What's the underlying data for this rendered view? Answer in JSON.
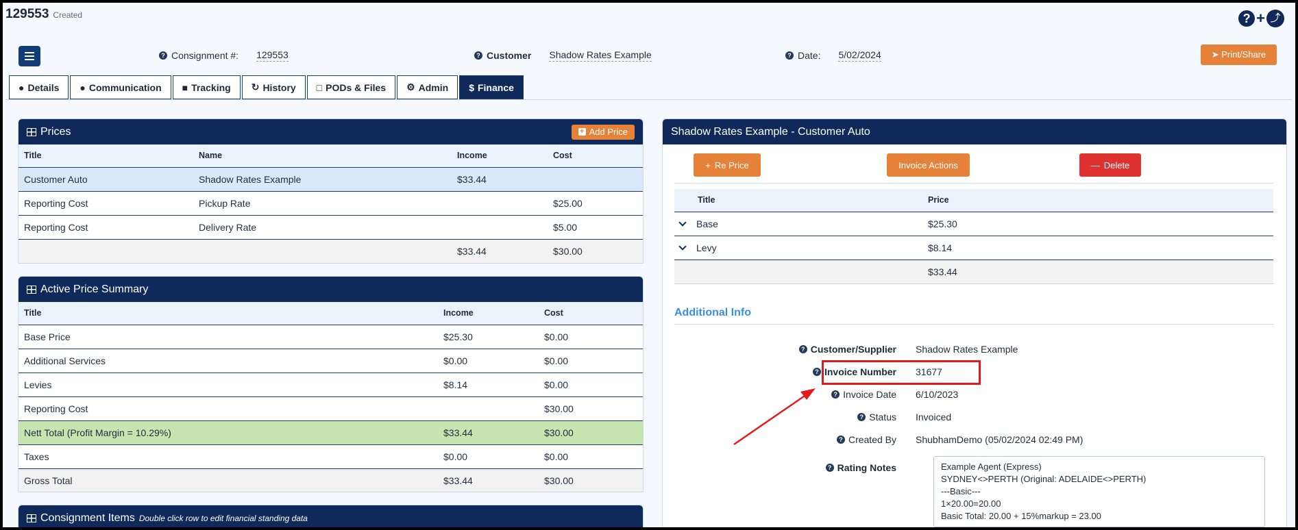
{
  "header": {
    "id": "129553",
    "status": "Created"
  },
  "fields": {
    "consignment_label": "Consignment #:",
    "consignment_value": "129553",
    "customer_label": "Customer",
    "customer_value": "Shadow Rates Example",
    "date_label": "Date:",
    "date_value": "5/02/2024"
  },
  "print_label": "Print/Share",
  "tabs": [
    {
      "label": "Details",
      "icon": "user-icon"
    },
    {
      "label": "Communication",
      "icon": "comment-icon"
    },
    {
      "label": "Tracking",
      "icon": "truck-icon"
    },
    {
      "label": "History",
      "icon": "history-icon"
    },
    {
      "label": "PODs & Files",
      "icon": "file-icon"
    },
    {
      "label": "Admin",
      "icon": "gear-icon"
    },
    {
      "label": "Finance",
      "icon": "dollar-icon"
    }
  ],
  "prices": {
    "title": "Prices",
    "add_label": "Add Price",
    "columns": [
      "Title",
      "Name",
      "Income",
      "Cost"
    ],
    "rows": [
      [
        "Customer Auto",
        "Shadow Rates Example",
        "$33.44",
        ""
      ],
      [
        "Reporting Cost",
        "Pickup Rate",
        "",
        "$25.00"
      ],
      [
        "Reporting Cost",
        "Delivery Rate",
        "",
        "$5.00"
      ]
    ],
    "total": [
      "",
      "",
      "$33.44",
      "$30.00"
    ]
  },
  "summary": {
    "title": "Active Price Summary",
    "columns": [
      "Title",
      "Income",
      "Cost"
    ],
    "rows": [
      [
        "Base Price",
        "$25.30",
        "$0.00"
      ],
      [
        "Additional Services",
        "$0.00",
        "$0.00"
      ],
      [
        "Levies",
        "$8.14",
        "$0.00"
      ],
      [
        "Reporting Cost",
        "",
        "$30.00"
      ],
      [
        "Nett Total (Profit Margin = 10.29%)",
        "$33.44",
        "$30.00"
      ],
      [
        "Taxes",
        "$0.00",
        "$0.00"
      ],
      [
        "Gross Total",
        "$33.44",
        "$30.00"
      ]
    ]
  },
  "items": {
    "title": "Consignment Items",
    "subtitle": "Double click row to edit financial standing data"
  },
  "detail": {
    "title": "Shadow Rates Example - Customer Auto",
    "reprice_label": "Re Price",
    "invoice_actions_label": "Invoice Actions",
    "delete_label": "Delete",
    "columns": [
      "Title",
      "Price"
    ],
    "rows": [
      [
        "Base",
        "$25.30"
      ],
      [
        "Levy",
        "$8.14"
      ]
    ],
    "total": "$33.44"
  },
  "additional": {
    "heading": "Additional Info",
    "customer_label": "Customer/Supplier",
    "customer_value": "Shadow Rates Example",
    "invoice_number_label": "Invoice Number",
    "invoice_number_value": "31677",
    "invoice_date_label": "Invoice Date",
    "invoice_date_value": "6/10/2023",
    "status_label": "Status",
    "status_value": "Invoiced",
    "created_by_label": "Created By",
    "created_by_value": "ShubhamDemo (05/02/2024 02:49 PM)",
    "rating_notes_label": "Rating Notes",
    "rating_notes": [
      "Example Agent (Express)",
      "SYDNEY<>PERTH (Original: ADELAIDE<>PERTH)",
      "---Basic---",
      "1×20.00=20.00",
      "Basic Total: 20.00 + 15%markup = 23.00"
    ]
  },
  "colors": {
    "navy": "#0f2a5a",
    "orange": "#e6813a",
    "red": "#e03131",
    "highlight": "#e01b1b"
  }
}
